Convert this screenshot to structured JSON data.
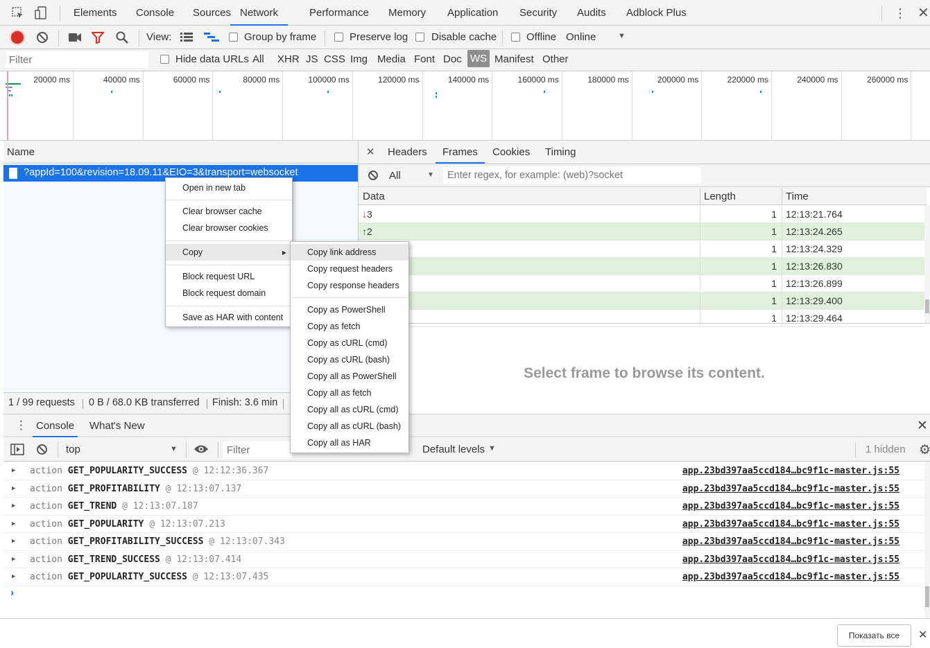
{
  "top_tabs": [
    "Elements",
    "Console",
    "Sources",
    "Network",
    "Performance",
    "Memory",
    "Application",
    "Security",
    "Audits",
    "Adblock Plus"
  ],
  "toolbar": {
    "view_label": "View:",
    "group_by_frame": "Group by frame",
    "preserve_log": "Preserve log",
    "disable_cache": "Disable cache",
    "offline": "Offline",
    "throttle": "Online"
  },
  "filter_bar": {
    "placeholder": "Filter",
    "hide_data_urls": "Hide data URLs",
    "types": [
      "All",
      "XHR",
      "JS",
      "CSS",
      "Img",
      "Media",
      "Font",
      "Doc",
      "WS",
      "Manifest",
      "Other"
    ],
    "active_type": "WS"
  },
  "overview": {
    "ticks": [
      "20000 ms",
      "40000 ms",
      "60000 ms",
      "80000 ms",
      "100000 ms",
      "120000 ms",
      "140000 ms",
      "160000 ms",
      "180000 ms",
      "200000 ms",
      "220000 ms",
      "240000 ms",
      "260000 ms"
    ]
  },
  "requests": {
    "header": "Name",
    "items": [
      {
        "name": "?appId=100&revision=18.09.11&EIO=3&transport=websocket"
      }
    ]
  },
  "context_menu": {
    "items": [
      "Open in new tab",
      "Clear browser cache",
      "Clear browser cookies",
      "Copy",
      "Block request URL",
      "Block request domain",
      "Save as HAR with content"
    ]
  },
  "copy_submenu": {
    "items": [
      "Copy link address",
      "Copy request headers",
      "Copy response headers",
      "Copy as PowerShell",
      "Copy as fetch",
      "Copy as cURL (cmd)",
      "Copy as cURL (bash)",
      "Copy all as PowerShell",
      "Copy all as fetch",
      "Copy all as cURL (cmd)",
      "Copy all as cURL (bash)",
      "Copy all as HAR"
    ],
    "highlighted": "Copy link address"
  },
  "detail_tabs": [
    "Headers",
    "Frames",
    "Cookies",
    "Timing"
  ],
  "frames": {
    "filter_select": "All",
    "filter_placeholder": "Enter regex, for example: (web)?socket",
    "columns": [
      "Data",
      "Length",
      "Time"
    ],
    "rows": [
      {
        "data": "3",
        "dir": "down",
        "length": "1",
        "time": "12:13:21.764",
        "green": false
      },
      {
        "data": "2",
        "dir": "up",
        "length": "1",
        "time": "12:13:24.265",
        "green": true
      },
      {
        "data": "",
        "dir": "",
        "length": "1",
        "time": "12:13:24.329",
        "green": false
      },
      {
        "data": "",
        "dir": "",
        "length": "1",
        "time": "12:13:26.830",
        "green": true
      },
      {
        "data": "",
        "dir": "",
        "length": "1",
        "time": "12:13:26.899",
        "green": false
      },
      {
        "data": "",
        "dir": "",
        "length": "1",
        "time": "12:13:29.400",
        "green": true
      },
      {
        "data": "",
        "dir": "",
        "length": "1",
        "time": "12:13:29.464",
        "green": false
      }
    ],
    "empty_message": "Select frame to browse its content."
  },
  "status": {
    "requests": "1 / 99 requests",
    "transferred": "0 B / 68.0 KB transferred",
    "finish": "Finish: 3.6 min"
  },
  "drawer": {
    "tabs": [
      "Console",
      "What's New"
    ],
    "context": "top",
    "filter_placeholder": "Filter",
    "levels": "Default levels",
    "hidden": "1 hidden"
  },
  "console_rows": [
    {
      "label": "action",
      "type": "GET_POPULARITY_SUCCESS",
      "at": "@",
      "time": "12:12:36.367",
      "src": "app.23bd397aa5ccd184…bc9f1c-master.js:55"
    },
    {
      "label": "action",
      "type": "GET_PROFITABILITY",
      "at": "@",
      "time": "12:13:07.137",
      "src": "app.23bd397aa5ccd184…bc9f1c-master.js:55"
    },
    {
      "label": "action",
      "type": "GET_TREND",
      "at": "@",
      "time": "12:13:07.187",
      "src": "app.23bd397aa5ccd184…bc9f1c-master.js:55"
    },
    {
      "label": "action",
      "type": "GET_POPULARITY",
      "at": "@",
      "time": "12:13:07.213",
      "src": "app.23bd397aa5ccd184…bc9f1c-master.js:55"
    },
    {
      "label": "action",
      "type": "GET_PROFITABILITY_SUCCESS",
      "at": "@",
      "time": "12:13:07.343",
      "src": "app.23bd397aa5ccd184…bc9f1c-master.js:55"
    },
    {
      "label": "action",
      "type": "GET_TREND_SUCCESS",
      "at": "@",
      "time": "12:13:07.414",
      "src": "app.23bd397aa5ccd184…bc9f1c-master.js:55"
    },
    {
      "label": "action",
      "type": "GET_POPULARITY_SUCCESS",
      "at": "@",
      "time": "12:13:07.435",
      "src": "app.23bd397aa5ccd184…bc9f1c-master.js:55"
    }
  ],
  "downloads_bar": {
    "show_all": "Показать все"
  },
  "colors": {
    "accent": "#1a73e8",
    "record": "#d93025",
    "green_row": "#e1f0dc"
  }
}
